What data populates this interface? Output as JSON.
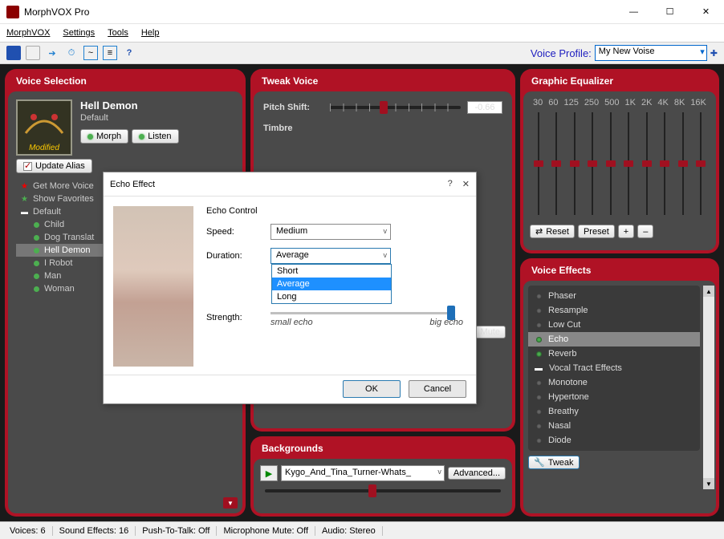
{
  "window": {
    "title": "MorphVOX Pro"
  },
  "menubar": [
    "MorphVOX",
    "Settings",
    "Tools",
    "Help"
  ],
  "voice_profile": {
    "label": "Voice Profile:",
    "value": "My New Voise"
  },
  "panels": {
    "voice_selection": {
      "title": "Voice Selection",
      "current": {
        "name": "Hell Demon",
        "sub": "Default",
        "modified": "Modified"
      },
      "buttons": {
        "morph": "Morph",
        "listen": "Listen",
        "update_alias": "Update Alias"
      },
      "tree": {
        "get_more": "Get More Voice",
        "show_fav": "Show Favorites",
        "default_group": "Default",
        "items": [
          "Child",
          "Dog Translat",
          "Hell Demon",
          "I Robot",
          "Man",
          "Woman"
        ]
      }
    },
    "tweak_voice": {
      "title": "Tweak Voice",
      "pitch_label": "Pitch Shift:",
      "pitch_value": "-0.66",
      "timbre_label": "Timbre",
      "mute": "Mute"
    },
    "backgrounds": {
      "title": "Backgrounds",
      "current": "Kygo_And_Tina_Turner-Whats_",
      "advanced": "Advanced..."
    },
    "equalizer": {
      "title": "Graphic Equalizer",
      "bands": [
        "30",
        "60",
        "125",
        "250",
        "500",
        "1K",
        "2K",
        "4K",
        "8K",
        "16K"
      ],
      "reset": "Reset",
      "preset": "Preset",
      "plus": "+",
      "minus": "–"
    },
    "voice_effects": {
      "title": "Voice Effects",
      "items": [
        "Phaser",
        "Resample",
        "Low Cut",
        "Echo",
        "Reverb"
      ],
      "group": "Vocal Tract Effects",
      "sub_items": [
        "Monotone",
        "Hypertone",
        "Breathy",
        "Nasal",
        "Diode"
      ],
      "tweak": "Tweak"
    }
  },
  "dialog": {
    "title": "Echo Effect",
    "group": "Echo Control",
    "speed": {
      "label": "Speed:",
      "value": "Medium"
    },
    "duration": {
      "label": "Duration:",
      "value": "Average",
      "options": [
        "Short",
        "Average",
        "Long"
      ]
    },
    "strength": {
      "label": "Strength:",
      "min_label": "small echo",
      "max_label": "big echo"
    },
    "ok": "OK",
    "cancel": "Cancel"
  },
  "statusbar": {
    "voices": "Voices: 6",
    "sfx": "Sound Effects: 16",
    "ptt": "Push-To-Talk: Off",
    "mic": "Microphone Mute: Off",
    "audio": "Audio: Stereo"
  }
}
